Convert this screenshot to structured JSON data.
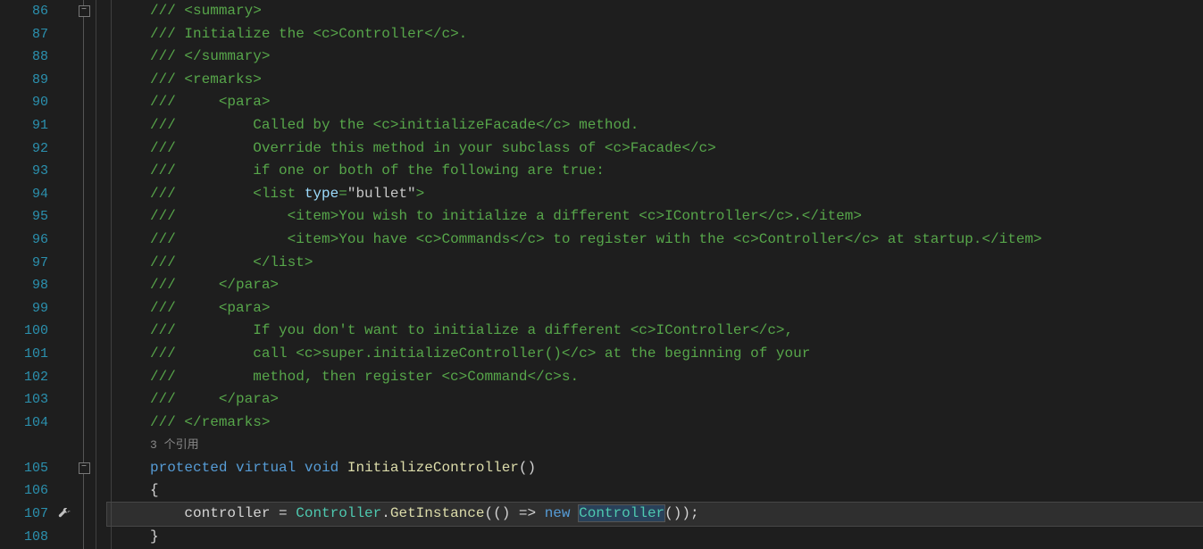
{
  "line_numbers": [
    "86",
    "87",
    "88",
    "89",
    "90",
    "91",
    "92",
    "93",
    "94",
    "95",
    "96",
    "97",
    "98",
    "99",
    "100",
    "101",
    "102",
    "103",
    "104",
    "",
    "105",
    "106",
    "107",
    "108"
  ],
  "codelens": "3 个引用",
  "current_line_marker_title": "edit-indicator",
  "lines": {
    "l86": {
      "prefix": "/// ",
      "tag": "<summary>"
    },
    "l87": {
      "prefix": "/// ",
      "text1": "Initialize the ",
      "tag1": "<c>",
      "text2": "Controller",
      "tag2": "</c>",
      "text3": "."
    },
    "l88": {
      "prefix": "/// ",
      "tag": "</summary>"
    },
    "l89": {
      "prefix": "/// ",
      "tag": "<remarks>"
    },
    "l90": {
      "prefix": "///     ",
      "tag": "<para>"
    },
    "l91": {
      "prefix": "///         ",
      "text1": "Called by the ",
      "tag1": "<c>",
      "text2": "initializeFacade",
      "tag2": "</c>",
      "text3": " method."
    },
    "l92": {
      "prefix": "///         ",
      "text1": "Override this method in your subclass of ",
      "tag1": "<c>",
      "text2": "Facade",
      "tag2": "</c>"
    },
    "l93": {
      "prefix": "///         ",
      "text1": "if one or both of the following are true:"
    },
    "l94": {
      "prefix": "///         ",
      "tag1": "<list ",
      "attr": "type",
      "eq": "=",
      "val": "\"bullet\"",
      "tag2": ">"
    },
    "l95": {
      "prefix": "///             ",
      "tag1": "<item>",
      "text1": "You wish to initialize a different ",
      "tag2": "<c>",
      "text2": "IController",
      "tag3": "</c>",
      "text3": ".",
      "tag4": "</item>"
    },
    "l96": {
      "prefix": "///             ",
      "tag1": "<item>",
      "text1": "You have ",
      "tag2": "<c>",
      "text2": "Commands",
      "tag3": "</c>",
      "text3": " to register with the ",
      "tag4": "<c>",
      "text4": "Controller",
      "tag5": "</c>",
      "text5": " at startup.",
      "tag6": "</item>"
    },
    "l97": {
      "prefix": "///         ",
      "tag": "</list>"
    },
    "l98": {
      "prefix": "///     ",
      "tag": "</para>"
    },
    "l99": {
      "prefix": "///     ",
      "tag": "<para>"
    },
    "l100": {
      "prefix": "///         ",
      "text1": "If you don't want to initialize a different ",
      "tag1": "<c>",
      "text2": "IController",
      "tag2": "</c>",
      "text3": ","
    },
    "l101": {
      "prefix": "///         ",
      "text1": "call ",
      "tag1": "<c>",
      "text2": "super.initializeController()",
      "tag2": "</c>",
      "text3": " at the beginning of your"
    },
    "l102": {
      "prefix": "///         ",
      "text1": "method, then register ",
      "tag1": "<c>",
      "text2": "Command",
      "tag2": "</c>",
      "text3": "s."
    },
    "l103": {
      "prefix": "///     ",
      "tag": "</para>"
    },
    "l104": {
      "prefix": "/// ",
      "tag": "</remarks>"
    },
    "l105": {
      "kw1": "protected",
      "sp1": " ",
      "kw2": "virtual",
      "sp2": " ",
      "kw3": "void",
      "sp3": " ",
      "method": "InitializeController",
      "p": "()"
    },
    "l106": {
      "brace": "{"
    },
    "l107": {
      "indent": "    ",
      "id1": "controller",
      "eq": " = ",
      "type1": "Controller",
      "dot": ".",
      "m1": "GetInstance",
      "p1": "(() => ",
      "kw": "new",
      "sp": " ",
      "type2": "Controller",
      "p2": "());"
    },
    "l108": {
      "brace": "}"
    }
  }
}
